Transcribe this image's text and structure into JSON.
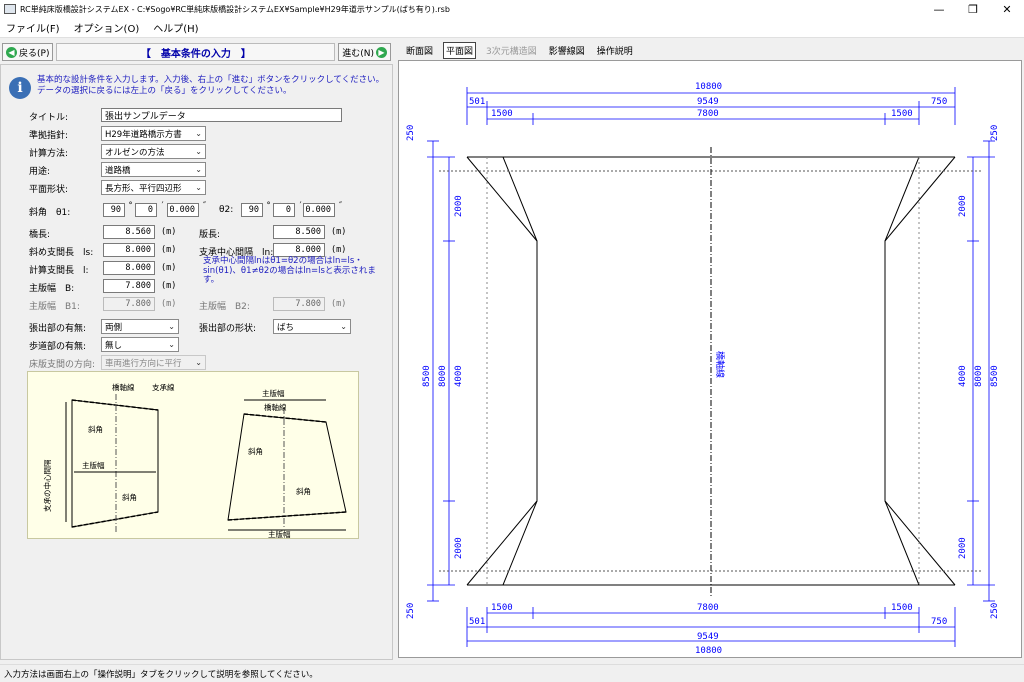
{
  "window": {
    "title": "RC単純床版橋設計システムEX - C:¥Sogo¥RC単純床版橋設計システムEX¥Sample¥H29年道示サンプル(ばち有り).rsb",
    "minimize": "—",
    "maximize": "❐",
    "close": "✕"
  },
  "menu": [
    "ファイル(F)",
    "オプション(O)",
    "ヘルプ(H)"
  ],
  "nav": {
    "back_label": "戻る(P)",
    "step_title": "【　基本条件の入力　】",
    "next_label": "進む(N)"
  },
  "info_text": "基本的な設計条件を入力します。入力後、右上の「進む」ボタンをクリックしてください。データの選択に戻るには左上の「戻る」をクリックしてください。",
  "form": {
    "title_label": "タイトル:",
    "title_value": "張出サンプルデータ",
    "standard_label": "準拠指針:",
    "standard_value": "H29年道路橋示方書",
    "method_label": "計算方法:",
    "method_value": "オルゼンの方法",
    "use_label": "用途:",
    "use_value": "道路橋",
    "shape_label": "平面形状:",
    "shape_value": "長方形、平行四辺形",
    "skew_label": "斜角　θ1:",
    "theta1_deg": "90",
    "theta1_min": "0",
    "theta1_sec": "0.000",
    "theta2_label": "θ2:",
    "theta2_deg": "90",
    "theta2_min": "0",
    "theta2_sec": "0.000",
    "deg_mark": "°",
    "min_mark": "′",
    "sec_mark": "″",
    "bridge_len_label": "橋長:",
    "bridge_len_value": "8.560",
    "beam_len_label": "版長:",
    "beam_len_value": "8.500",
    "skew_span_label": "斜め支間長　ls:",
    "skew_span_value": "8.000",
    "bearing_span_label": "支承中心間隔　ln:",
    "bearing_span_value": "8.000",
    "calc_span_label": "計算支間長　l:",
    "calc_span_value": "8.000",
    "main_width_label": "主版幅　B:",
    "main_width_value": "7.800",
    "main_width1_label": "主版幅　B1:",
    "main_width1_value": "7.800",
    "main_width2_label": "主版幅　B2:",
    "main_width2_value": "7.800",
    "unit_m": "(m)",
    "note": "支承中心間隔lnはθ1=θ2の場合はln=ls・sin(θ1)、θ1≠θ2の場合はln=lsと表示されます。",
    "overhang_label": "張出部の有無:",
    "overhang_value": "両側",
    "overhang_shape_label": "張出部の形状:",
    "overhang_shape_value": "ばち",
    "sidewalk_label": "歩道部の有無:",
    "sidewalk_value": "無し",
    "slab_dir_label": "床版支間の方向:",
    "slab_dir_value": "車両進行方向に平行"
  },
  "diagram": {
    "bridge_axis": "橋軸線",
    "bearing_line": "支承線",
    "bearing_span": "支承の中心間隔",
    "main_width": "主版幅",
    "skew": "斜角",
    "main_width_b1": "主版幅",
    "main_width_b2": "主版幅"
  },
  "tabs": [
    "断面図",
    "平面図",
    "3次元構造図",
    "影響線図",
    "操作説明"
  ],
  "active_tab": 1,
  "drawing": {
    "dim_total": "10800",
    "dim_inner": "9549",
    "dim_main": "7800",
    "dim_side": "1500",
    "dim_left_edge": "501",
    "dim_right_edge": "750",
    "dim_end": "250",
    "dim_taper": "2000",
    "dim_mid": "4000",
    "dim_len1": "8000",
    "dim_len2": "8500",
    "axis_label": "橋軸線"
  },
  "status": "入力方法は画面右上の「操作説明」タブをクリックして説明を参照してください。",
  "colors": {
    "dimension": "#0000ff",
    "outline": "#000000",
    "accent_text": "#2020c0"
  }
}
